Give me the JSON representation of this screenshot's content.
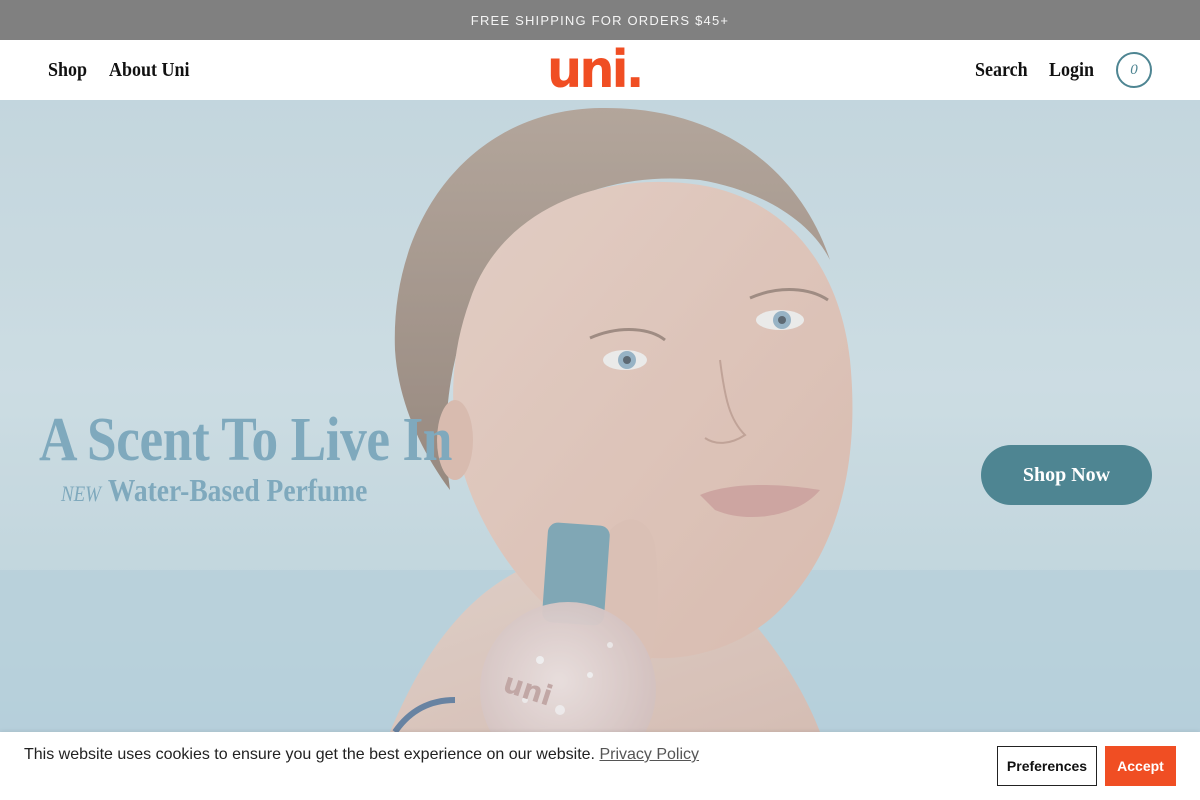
{
  "announcement": {
    "text": "FREE SHIPPING FOR ORDERS $45+"
  },
  "nav": {
    "left": [
      {
        "label": "Shop"
      },
      {
        "label": "About Uni"
      }
    ],
    "logo": {
      "text": "uni",
      "dot": ".",
      "color": "#f04e23"
    },
    "search_label": "Search",
    "login_label": "Login",
    "cart": {
      "count": "0",
      "icon": "cart-bubble-icon"
    }
  },
  "hero": {
    "headline": "A Scent To Live In",
    "badge": "NEW",
    "subheadline": "Water-Based Perfume",
    "cta_label": "Shop Now",
    "bottle_label": "uni"
  },
  "cookie": {
    "text": "This website uses cookies to ensure you get the best experience on our website.",
    "link_label": "Privacy Policy",
    "preferences_label": "Preferences",
    "accept_label": "Accept"
  },
  "colors": {
    "brand": "#f04e23",
    "teal": "#4e8592",
    "hero_text": "#7fa9bd",
    "announcement_bg": "#808080"
  }
}
